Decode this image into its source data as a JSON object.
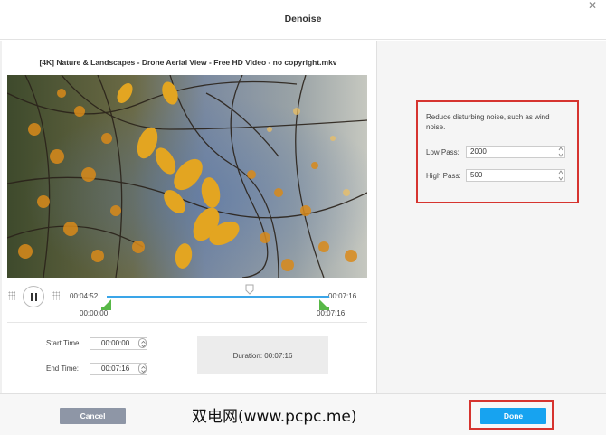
{
  "dialog": {
    "title": "Denoise",
    "close_glyph": "✕"
  },
  "video": {
    "filename": "[4K] Nature & Landscapes - Drone Aerial View - Free HD Video - no copyright.mkv",
    "current_time": "00:04:52",
    "start_marker": "00:00:00",
    "end_marker": "00:07:16",
    "total_time": "00:07:16"
  },
  "trim": {
    "start_label": "Start Time:",
    "start_value": "00:00:00",
    "end_label": "End Time:",
    "end_value": "00:07:16",
    "duration_label": "Duration:",
    "duration_value": "00:07:16"
  },
  "denoise": {
    "description": "Reduce disturbing noise, such as wind noise.",
    "low_pass_label": "Low Pass:",
    "low_pass_value": "2000",
    "high_pass_label": "High Pass:",
    "high_pass_value": "500"
  },
  "footer": {
    "cancel_label": "Cancel",
    "done_label": "Done",
    "watermark": "双电网(www.pcpc.me)"
  },
  "colors": {
    "accent_blue": "#17a3f0",
    "track_blue": "#3aa5e8",
    "trim_green": "#58b847",
    "annotation_red": "#d6342f",
    "cancel_gray": "#8e96a6"
  },
  "icons": [
    "close-icon",
    "pause-icon",
    "grip-icon",
    "playhead-icon",
    "spin-icon",
    "stepper-icon"
  ]
}
